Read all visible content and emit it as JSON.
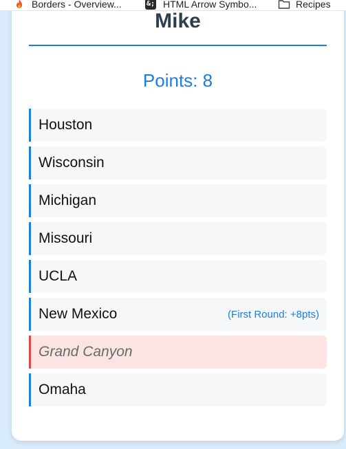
{
  "bookmarks": [
    {
      "label": "Borders - Overview...",
      "icon": "flame-icon"
    },
    {
      "label": "HTML Arrow Symbo...",
      "icon": "&;"
    },
    {
      "label": "Recipes",
      "icon": "folder-icon"
    }
  ],
  "card": {
    "player_name": "Mike",
    "points": "Points: 8"
  },
  "picks": [
    {
      "name": "Houston",
      "note": "",
      "status": "active"
    },
    {
      "name": "Wisconsin",
      "note": "",
      "status": "active"
    },
    {
      "name": "Michigan",
      "note": "",
      "status": "active"
    },
    {
      "name": "Missouri",
      "note": "",
      "status": "active"
    },
    {
      "name": "UCLA",
      "note": "",
      "status": "active"
    },
    {
      "name": "New Mexico",
      "note": "(First Round: +8pts)",
      "status": "active"
    },
    {
      "name": "Grand Canyon",
      "note": "",
      "status": "eliminated"
    },
    {
      "name": "Omaha",
      "note": "",
      "status": "active"
    }
  ],
  "colors": {
    "accent": "#1a7fe0",
    "eliminated_border": "#e04848",
    "eliminated_bg": "#fde4e4",
    "page_bg": "#d9ecfb"
  }
}
